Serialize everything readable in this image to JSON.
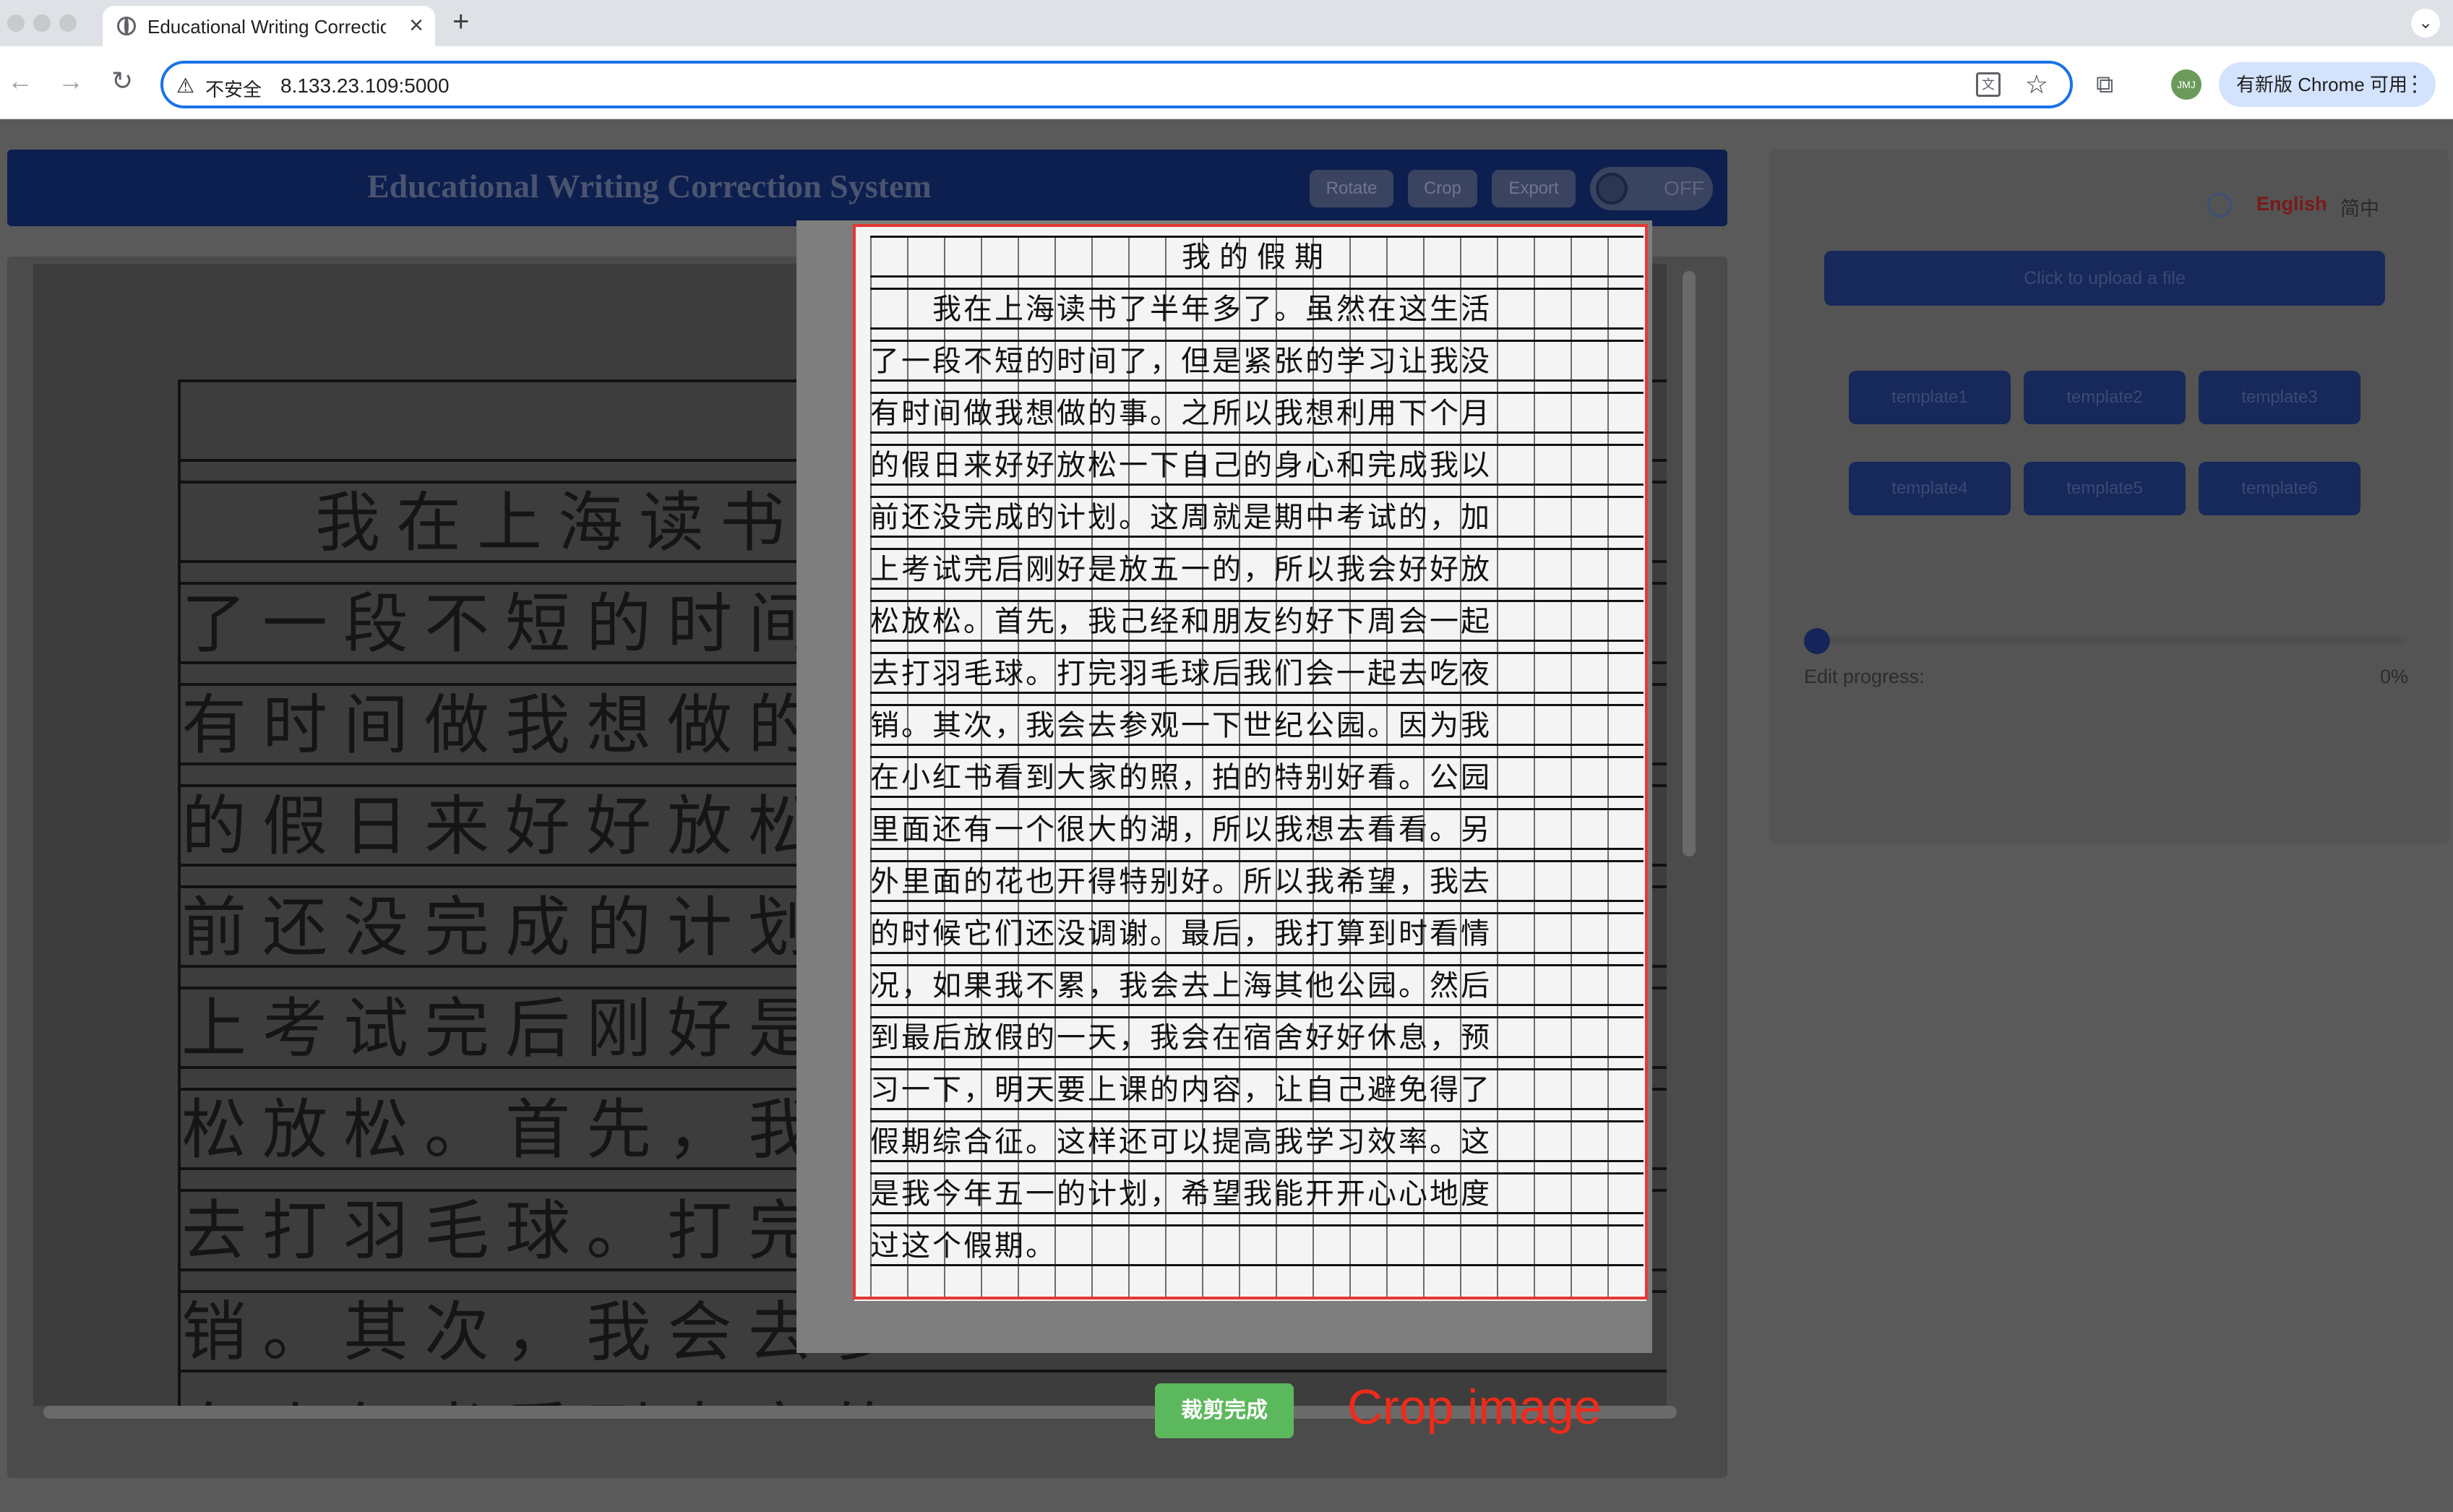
{
  "browser": {
    "tab_title": "Educational Writing Correctio",
    "tab_close": "×",
    "new_tab": "+",
    "tab_menu": "⌄",
    "security_label": "不安全",
    "url": "8.133.23.109:5000",
    "update_label": "有新版 Chrome 可用",
    "profile_initials": "JMJ"
  },
  "header": {
    "title": "Educational Writing Correction System",
    "buttons": {
      "rotate": "Rotate",
      "crop": "Crop",
      "export": "Export"
    },
    "toggle_label": "OFF"
  },
  "sidebar": {
    "lang_english": "English",
    "lang_chinese": "简中",
    "upload_label": "Click to upload a file",
    "templates": [
      "template1",
      "template2",
      "template3",
      "template4",
      "template5",
      "template6"
    ],
    "progress_label": "Edit progress:",
    "progress_value": "0%",
    "progress_fraction": 0
  },
  "background_doc": {
    "lines": [
      "我在上海读书了",
      "了一段不短的时间了",
      "有时间做我想做的事",
      "的假日来好好放松一",
      "前还没完成的计划。",
      "上考试完后刚好是放",
      "松放松。首先，我己",
      "去打羽毛球。打完羽",
      "销。其次，我会去参",
      "在小红书看到大家的"
    ]
  },
  "crop_dialog": {
    "essay_title": "我的假期",
    "essay_lines": [
      "　　我在上海读书了半年多了。虽然在这生活",
      "了一段不短的时间了，但是紧张的学习让我没",
      "有时间做我想做的事。之所以我想利用下个月",
      "的假日来好好放松一下自己的身心和完成我以",
      "前还没完成的计划。这周就是期中考试的，加",
      "上考试完后刚好是放五一的，所以我会好好放",
      "松放松。首先，我己经和朋友约好下周会一起",
      "去打羽毛球。打完羽毛球后我们会一起去吃夜",
      "销。其次，我会去参观一下世纪公园。因为我",
      "在小红书看到大家的照，拍的特别好看。公园",
      "里面还有一个很大的湖，所以我想去看看。另",
      "外里面的花也开得特别好。所以我希望，我去",
      "的时候它们还没调谢。最后，我打算到时看情",
      "况，如果我不累，我会去上海其他公园。然后",
      "到最后放假的一天，我会在宿舍好好休息，预",
      "习一下，明天要上课的内容，让自己避免得了",
      "假期综合征。这样还可以提高我学习效率。这",
      "是我今年五一的计划，希望我能开开心心地度",
      "过这个假期。"
    ],
    "done_button": "裁剪完成",
    "annotation": "Crop image"
  }
}
